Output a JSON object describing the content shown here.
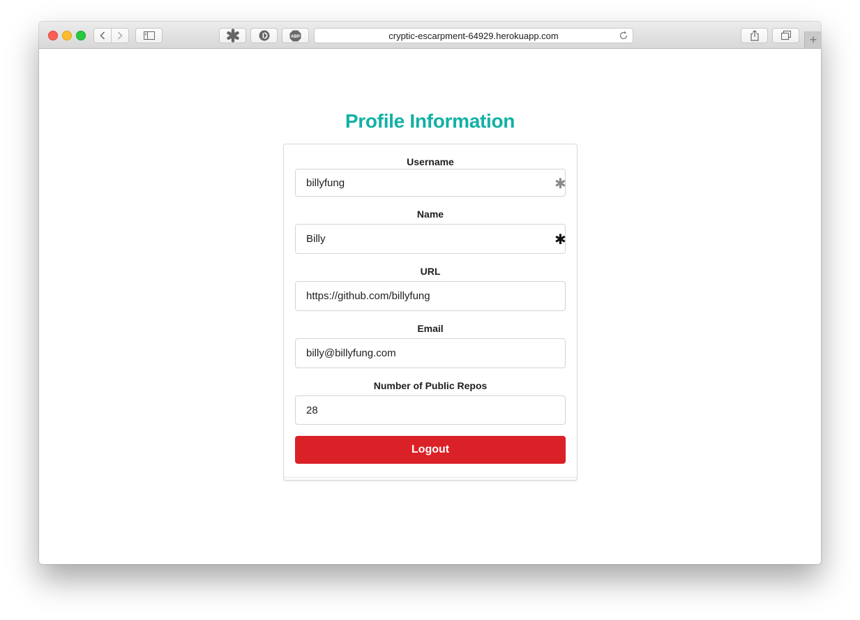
{
  "browser": {
    "url": "cryptic-escarpment-64929.herokuapp.com",
    "extensions": [
      {
        "icon": "asterisk-extension-icon"
      },
      {
        "icon": "disconnect-extension-icon"
      },
      {
        "icon": "adblock-plus-extension-icon",
        "label": "ABP"
      }
    ]
  },
  "page": {
    "title": "Profile Information",
    "title_color": "#12b1a4"
  },
  "form": {
    "fields": [
      {
        "label": "Username",
        "value": "billyfung",
        "required": true
      },
      {
        "label": "Name",
        "value": "Billy",
        "required": true
      },
      {
        "label": "URL",
        "value": "https://github.com/billyfung",
        "required": false
      },
      {
        "label": "Email",
        "value": "billy@billyfung.com",
        "required": false
      },
      {
        "label": "Number of Public Repos",
        "value": "28",
        "required": false
      }
    ],
    "logout_label": "Logout",
    "logout_color": "#db2128"
  }
}
